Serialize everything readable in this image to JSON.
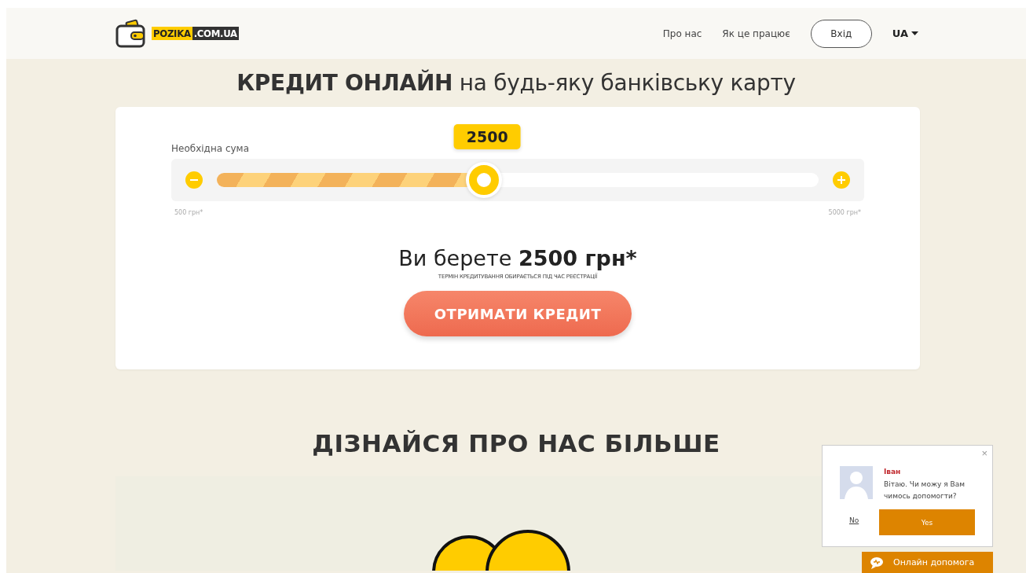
{
  "header": {
    "logo": {
      "part_1": "POZIKA",
      "part_2": ".COM.UA"
    },
    "nav": [
      "Про нас",
      "Як це працює"
    ],
    "login_button": "Вхід",
    "language": "UA"
  },
  "hero_title": "**КРЕДИТ ОНЛАЙН** на будь-яку банківську карту",
  "calculator": {
    "label": "Необхідна сума",
    "value_bubble": "2500",
    "slider": {
      "level": 0.444,
      "min_label": "500 грн*",
      "max_label": "5000 грн*"
    },
    "summary_prefix": "Ви берете",
    "summary_amount": "2500 грн*",
    "note": "ТЕРМІН КРЕДИТУВАННЯ ОБИРАЄТЬСЯ ПІД ЧАС РЕЄСТРАЦІЇ",
    "submit_button": "ОТРИМАТИ КРЕДИТ"
  },
  "about": {
    "title": "ДІЗНАЙСЯ ПРО НАС БІЛЬШЕ"
  },
  "chat": {
    "close": "×",
    "agent_name": "Іван",
    "message": "Вітаю. Чи можу я Вам чимось допомогти?",
    "no_button": "No",
    "yes_button": "Yes",
    "launcher": "Онлайн допомога"
  }
}
